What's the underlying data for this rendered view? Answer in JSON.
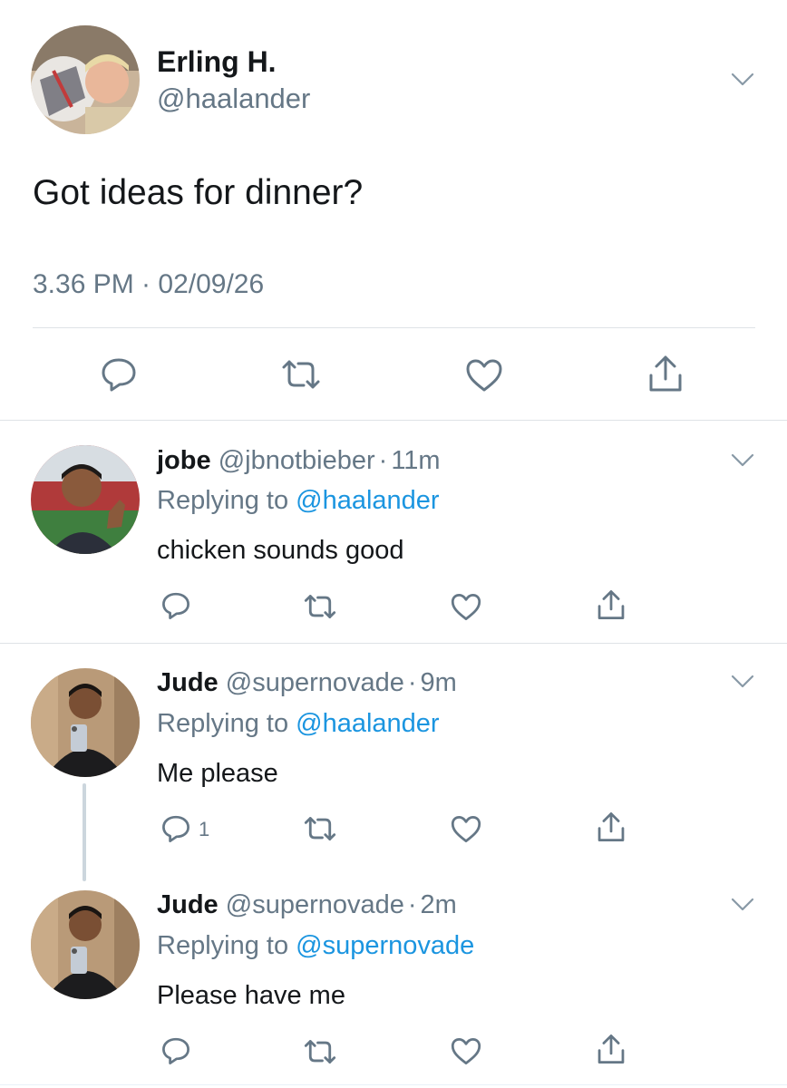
{
  "main_tweet": {
    "display_name": "Erling H.",
    "handle": "@haalander",
    "text": "Got ideas for dinner?",
    "timestamp": "3.36 PM · 02/09/26"
  },
  "replies": [
    {
      "display_name": "jobe",
      "handle": "@jbnotbieber",
      "time": "11m",
      "replying_prefix": "Replying to",
      "replying_to": "@haalander",
      "text": "chicken sounds good",
      "reply_count": ""
    },
    {
      "display_name": "Jude",
      "handle": "@supernovade",
      "time": "9m",
      "replying_prefix": "Replying to",
      "replying_to": "@haalander",
      "text": "Me please",
      "reply_count": "1"
    },
    {
      "display_name": "Jude",
      "handle": "@supernovade",
      "time": "2m",
      "replying_prefix": "Replying to",
      "replying_to": "@supernovade",
      "text": "Please have me",
      "reply_count": ""
    }
  ],
  "separator": "·",
  "icons": [
    "reply-icon",
    "retweet-icon",
    "like-icon",
    "share-icon",
    "chevron-down-icon"
  ],
  "colors": {
    "link": "#1b95e0",
    "muted": "#657786",
    "divider": "#dfe3e6",
    "icon": "#657786"
  }
}
